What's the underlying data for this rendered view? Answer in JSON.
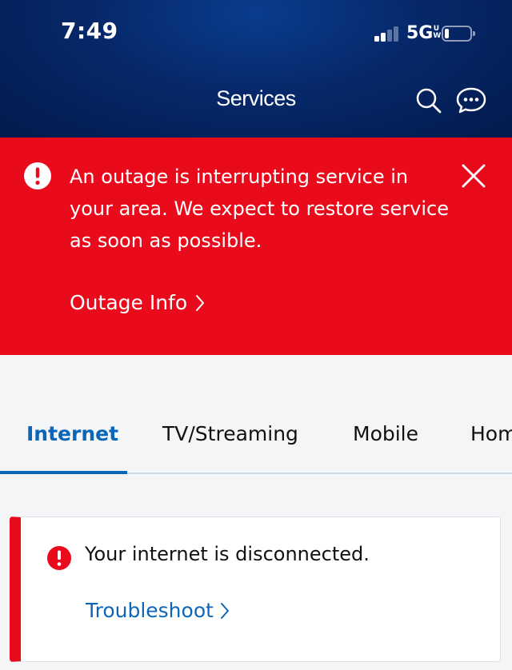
{
  "status_bar": {
    "time": "7:49",
    "network": "5G",
    "network_badge_top": "U",
    "network_badge_bottom": "W",
    "signal_bars_filled": 2,
    "signal_bars_total": 4,
    "battery_level": 0.15
  },
  "header": {
    "title": "Services",
    "search_icon": "search-icon",
    "chat_icon": "chat-bubble-icon",
    "background_color": "#06286a"
  },
  "alert": {
    "message": "An outage is interrupting service in your area. We expect to restore service as soon as possible.",
    "link_label": "Outage Info",
    "icon": "exclamation-circle-icon",
    "close_icon": "close-icon",
    "background_color": "#e90b1c"
  },
  "tabs": {
    "active_index": 0,
    "items": [
      {
        "label": "Internet"
      },
      {
        "label": "TV/Streaming"
      },
      {
        "label": "Mobile"
      },
      {
        "label": "Home"
      }
    ],
    "accent_color": "#0b66b8"
  },
  "card": {
    "message": "Your internet is disconnected.",
    "link_label": "Troubleshoot",
    "icon": "exclamation-circle-icon",
    "status_color": "#e90b1c"
  }
}
